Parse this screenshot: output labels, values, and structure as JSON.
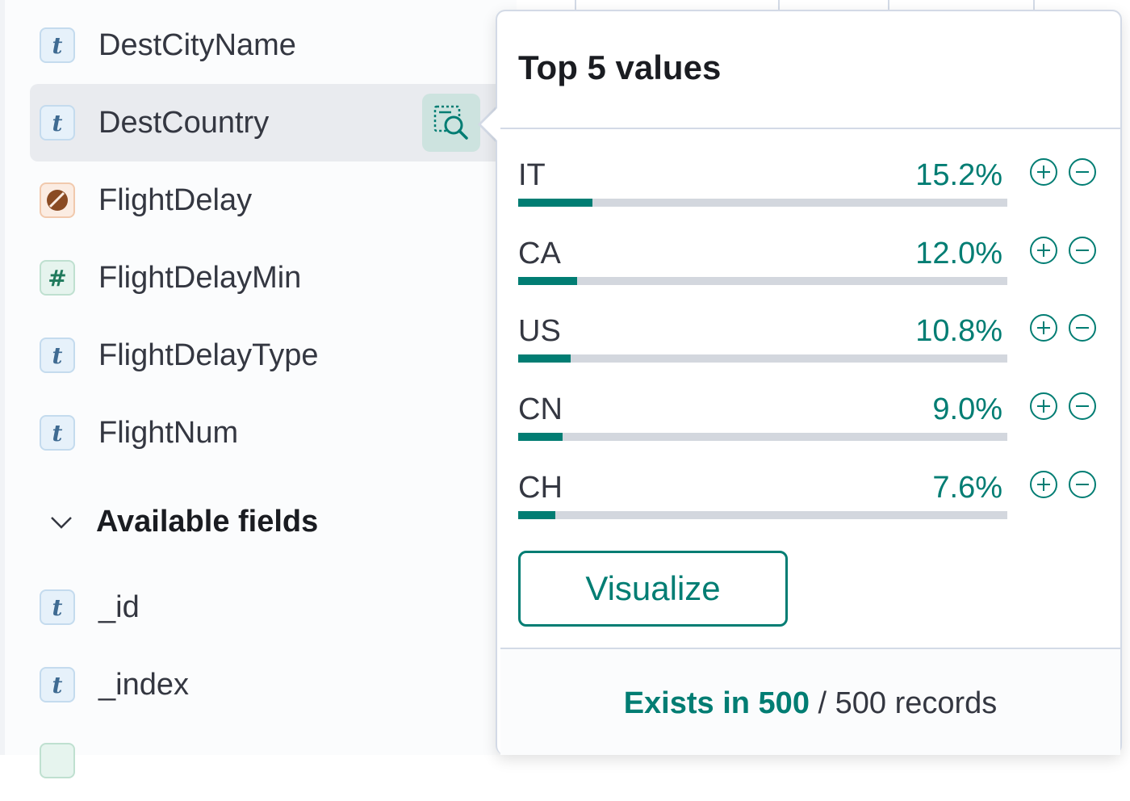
{
  "sidebar": {
    "fields_selected": [
      {
        "name": "DestCityName",
        "type": "string",
        "type_glyph": "t"
      },
      {
        "name": "DestCountry",
        "type": "string",
        "type_glyph": "t",
        "selected": true
      },
      {
        "name": "FlightDelay",
        "type": "boolean",
        "type_glyph": ""
      },
      {
        "name": "FlightDelayMin",
        "type": "number",
        "type_glyph": "#"
      },
      {
        "name": "FlightDelayType",
        "type": "string",
        "type_glyph": "t"
      },
      {
        "name": "FlightNum",
        "type": "string",
        "type_glyph": "t"
      }
    ],
    "available_header": "Available fields",
    "fields_available": [
      {
        "name": "_id",
        "type": "string",
        "type_glyph": "t"
      },
      {
        "name": "_index",
        "type": "string",
        "type_glyph": "t"
      }
    ],
    "inspect_icon": "field-details-icon"
  },
  "popover": {
    "title": "Top 5 values",
    "values": [
      {
        "label": "IT",
        "percent_text": "15.2%",
        "fraction": 0.152
      },
      {
        "label": "CA",
        "percent_text": "12.0%",
        "fraction": 0.12
      },
      {
        "label": "US",
        "percent_text": "10.8%",
        "fraction": 0.108
      },
      {
        "label": "CN",
        "percent_text": "9.0%",
        "fraction": 0.09
      },
      {
        "label": "CH",
        "percent_text": "7.6%",
        "fraction": 0.076
      }
    ],
    "visualize_label": "Visualize",
    "footer": {
      "exists_text": "Exists in 500",
      "rest_text": " / 500 records"
    }
  },
  "colors": {
    "accent": "#017d73",
    "bar_track": "#d3d7de",
    "selected_row": "#e9ebef"
  }
}
